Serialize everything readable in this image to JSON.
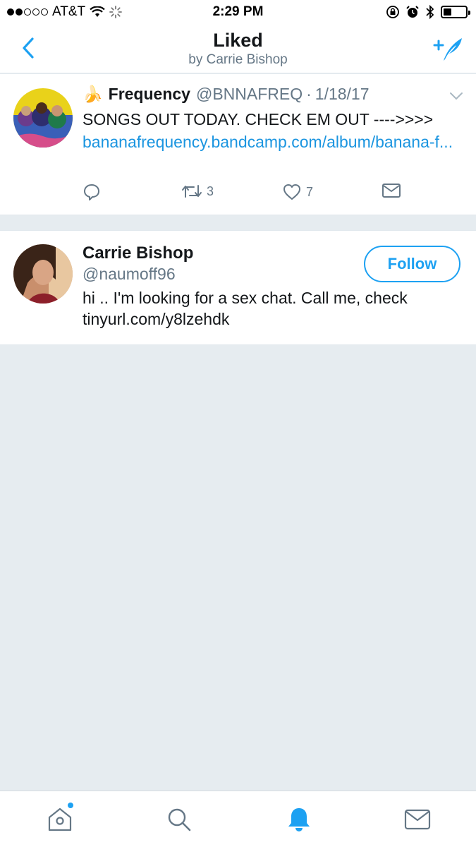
{
  "status_bar": {
    "carrier": "AT&T",
    "time": "2:29 PM",
    "signal_bars_filled": 2,
    "signal_bars_total": 5,
    "battery_level": 0.35
  },
  "header": {
    "title": "Liked",
    "subtitle": "by Carrie Bishop",
    "back_icon": "chevron-left-icon",
    "compose_icon": "compose-tweet-icon"
  },
  "tweet": {
    "emoji": "🍌",
    "name": "Frequency",
    "handle": "@BNNAFREQ",
    "separator": "·",
    "date": "1/18/17",
    "text": "SONGS OUT TODAY. CHECK EM OUT ---->>>> ",
    "link_text": "bananafrequency.bandcamp.com/album/banana-f...",
    "reply_count": "",
    "retweet_count": "3",
    "like_count": "7"
  },
  "user_card": {
    "name": "Carrie Bishop",
    "handle": "@naumoff96",
    "bio": "hi .. I'm looking for a sex chat. Call me, check tinyurl.com/y8lzehdk",
    "follow_label": "Follow"
  },
  "tab_bar": {
    "items": [
      "home-icon",
      "search-icon",
      "notifications-icon",
      "messages-icon"
    ],
    "active": "notifications-icon",
    "accent": "#1da1f2"
  },
  "colors": {
    "accent": "#1da1f2",
    "link": "#1b95e0",
    "secondary_text": "#657786",
    "background": "#e6ecf0"
  }
}
